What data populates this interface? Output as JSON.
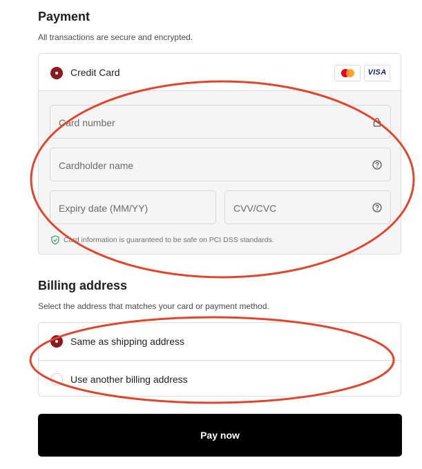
{
  "payment": {
    "title": "Payment",
    "subtitle": "All transactions are secure and encrypted.",
    "method": {
      "label": "Credit Card",
      "selected": true,
      "brands": [
        "mastercard-icon",
        "visa-icon"
      ],
      "visa_text": "VISA"
    },
    "fields": {
      "card_number": {
        "placeholder": "Card number",
        "icon": "lock-icon"
      },
      "cardholder_name": {
        "placeholder": "Cardholder name",
        "icon": "help-circle-icon"
      },
      "expiry": {
        "placeholder": "Expiry date (MM/YY)"
      },
      "cvv": {
        "placeholder": "CVV/CVC",
        "icon": "help-circle-icon"
      }
    },
    "secure_note": "Card information is guaranteed to be safe on PCI DSS standards."
  },
  "billing": {
    "title": "Billing address",
    "subtitle": "Select the address that matches your card or payment method.",
    "options": [
      {
        "label": "Same as shipping address",
        "selected": true
      },
      {
        "label": "Use another billing address",
        "selected": false
      }
    ]
  },
  "actions": {
    "pay_label": "Pay now"
  },
  "colors": {
    "accent_radio": "#8a1a21",
    "annotation": "#e0452c",
    "pay_button": "#000000"
  }
}
